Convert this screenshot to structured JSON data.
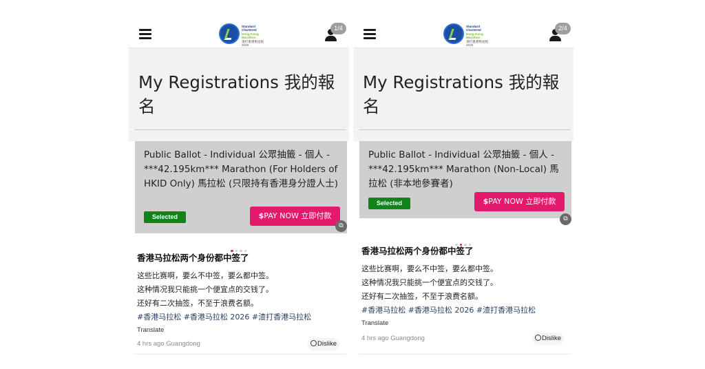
{
  "panels": [
    {
      "counter": "1/4",
      "page_title": "My Registrations 我的報名",
      "card": {
        "title": "Public Ballot - Individual 公眾抽籤 - 個人 -    ***42.195km*** Marathon (For Holders of HKID Only) 馬拉松 (只限持有香港身分證人士)",
        "status": "Selected",
        "pay_symbol": "$",
        "pay_label": "PAY NOW 立即付款"
      },
      "post": {
        "title": "香港马拉松两个身份都中签了",
        "lines": [
          "这些比赛啊，要么不中签，要么都中签。",
          "这种情况我只能挑一个便宜点的交钱了。",
          "还好有二次抽签，不至于浪费名额。"
        ],
        "hashtags": "#香港马拉松 #香港马拉松 2026 #渣打香港马拉松",
        "translate": "Translate",
        "meta": "4 hrs ago Guangdong",
        "dislike": "Dislike"
      }
    },
    {
      "counter": "2/4",
      "page_title": "My Registrations 我的報名",
      "card": {
        "title": "Public Ballot - Individual 公眾抽籤 - 個人 -    ***42.195km*** Marathon (Non-Local) 馬拉松 (非本地參賽者)",
        "status": "Selected",
        "pay_symbol": "$",
        "pay_label": "PAY NOW 立即付款"
      },
      "post": {
        "title": "香港马拉松两个身份都中签了",
        "lines": [
          "这些比赛啊，要么不中签，要么都中签。",
          "这种情况我只能挑一个便宜点的交钱了。",
          "还好有二次抽签，不至于浪费名额。"
        ],
        "hashtags": "#香港马拉松 #香港马拉松 2026 #渣打香港马拉松",
        "translate": "Translate",
        "meta": "4 hrs ago Guangdong",
        "dislike": "Dislike"
      }
    }
  ],
  "logo": {
    "line1": "Standard",
    "line2": "Chartered",
    "line3": "Hong Kong",
    "line4": "Marathon",
    "line5": "渣打香港馬拉松",
    "line6": "2026"
  },
  "icons": {
    "menu": "hamburger-menu-icon",
    "user": "user-icon",
    "translate": "translate-icon",
    "dislike": "smile-icon"
  },
  "colors": {
    "accent": "#e5196b",
    "selected": "#10841b",
    "card": "#cfcfcf",
    "header_bg": "#f2f2f2"
  }
}
